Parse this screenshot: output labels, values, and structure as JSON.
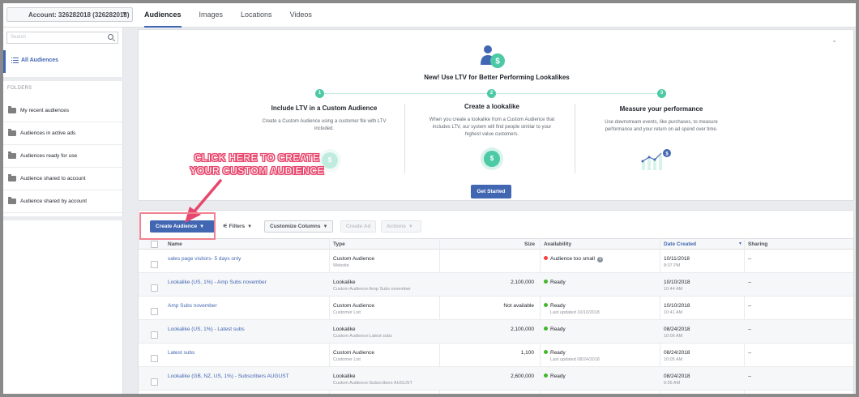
{
  "account": {
    "label": "Account: 326282018 (326282018)"
  },
  "tabs": [
    {
      "label": "Audiences",
      "active": true
    },
    {
      "label": "Images"
    },
    {
      "label": "Locations"
    },
    {
      "label": "Videos"
    }
  ],
  "sidebar": {
    "search_placeholder": "Search",
    "all_audiences": "All Audiences",
    "folders_heading": "FOLDERS",
    "folders": [
      "My recent audiences",
      "Audiences in active ads",
      "Audiences ready for use",
      "Audience shared to account",
      "Audience shared by account"
    ]
  },
  "banner": {
    "title": "New! Use LTV for Better Performing Lookalikes",
    "steps": [
      {
        "num": "1",
        "title": "Include LTV in a Custom Audience",
        "text": "Create a Custom Audience using a customer file with LTV included."
      },
      {
        "num": "2",
        "title": "Create a lookalike",
        "text": "When you create a lookalike from a Custom Audience that includes LTV, our system will find people similar to your highest value customers."
      },
      {
        "num": "3",
        "title": "Measure your performance",
        "text": "Use downstream events, like purchases, to measure performance and your return on ad spend over time."
      }
    ],
    "coin_symbol": "$",
    "get_started": "Get Started"
  },
  "annotation": {
    "line1": "CLICK HERE TO CREATE",
    "line2": "YOUR CUSTOM AUDIENCE"
  },
  "toolbar": {
    "create_audience": "Create Audience",
    "filters": "Filters",
    "customize_columns": "Customize Columns",
    "create_ad": "Create Ad",
    "actions": "Actions"
  },
  "table": {
    "headers": {
      "name": "Name",
      "type": "Type",
      "size": "Size",
      "availability": "Availability",
      "date_created": "Date Created",
      "sharing": "Sharing"
    },
    "rows": [
      {
        "name": "sales page visitors- 5 days only",
        "type": "Custom Audience",
        "type_sub": "Website",
        "size": "",
        "availability": "Audience too small",
        "avail_sub": "",
        "status_color": "#fa3e3e",
        "date": "10/11/2018",
        "time": "8:07 PM",
        "sharing": "--"
      },
      {
        "name": "Lookalike (US, 1%) - Amp Subs november",
        "type": "Lookalike",
        "type_sub": "Custom Audience:Amp Subs november",
        "size": "2,100,000",
        "availability": "Ready",
        "avail_sub": "",
        "status_color": "#42b72a",
        "date": "10/10/2018",
        "time": "10:44 AM",
        "sharing": "--"
      },
      {
        "name": "Amp Subs november",
        "type": "Custom Audience",
        "type_sub": "Customer List",
        "size": "Not available",
        "availability": "Ready",
        "avail_sub": "Last updated 10/10/2018",
        "status_color": "#42b72a",
        "date": "10/10/2018",
        "time": "10:41 AM",
        "sharing": "--"
      },
      {
        "name": "Lookalike (US, 1%) - Latest subs",
        "type": "Lookalike",
        "type_sub": "Custom Audience:Latest subs",
        "size": "2,100,000",
        "availability": "Ready",
        "avail_sub": "",
        "status_color": "#42b72a",
        "date": "08/24/2018",
        "time": "10:06 AM",
        "sharing": "--"
      },
      {
        "name": "Latest subs",
        "type": "Custom Audience",
        "type_sub": "Customer List",
        "size": "1,100",
        "availability": "Ready",
        "avail_sub": "Last updated 08/24/2018",
        "status_color": "#42b72a",
        "date": "08/24/2018",
        "time": "10:05 AM",
        "sharing": "--"
      },
      {
        "name": "Lookalike (GB, NZ, US, 1%) - Subscribers AUGUST",
        "type": "Lookalike",
        "type_sub": "Custom Audience:Subscribers AUGUST",
        "size": "2,600,000",
        "availability": "Ready",
        "avail_sub": "",
        "status_color": "#42b72a",
        "date": "08/24/2018",
        "time": "9:55 AM",
        "sharing": "--"
      }
    ]
  },
  "colors": {
    "accent": "#4267b2",
    "success": "#42b72a",
    "teal": "#4cc9a5",
    "annotation": "#e8476d"
  },
  "icons": {
    "search": "search-icon",
    "list": "list-icon",
    "folder": "folder-icon",
    "info": "info-icon",
    "chevron": "chevron-down-icon"
  }
}
